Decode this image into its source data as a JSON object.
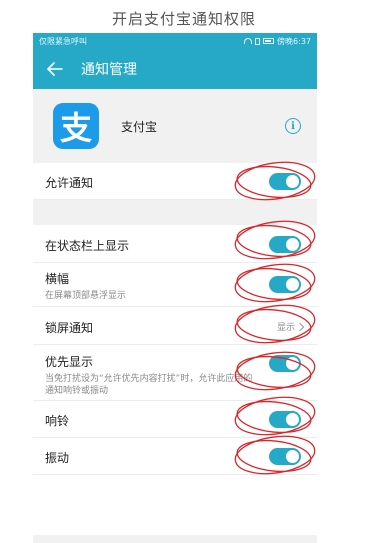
{
  "caption": "开启支付宝通知权限",
  "status_bar": {
    "left_text": "仅限紧急呼叫",
    "right_text": "傍晚6:37"
  },
  "app_bar": {
    "title": "通知管理",
    "back_icon": "back-arrow-icon"
  },
  "app": {
    "logo_glyph": "支",
    "name": "支付宝",
    "info_icon": "info-icon",
    "info_glyph": "i"
  },
  "settings": {
    "allow_notifications": {
      "title": "允许通知",
      "enabled": true
    },
    "status_bar_show": {
      "title": "在状态栏上显示",
      "enabled": true
    },
    "banner": {
      "title": "横幅",
      "subtitle": "在屏幕顶部悬浮显示",
      "enabled": true
    },
    "lock_screen": {
      "title": "锁屏通知",
      "value": "显示"
    },
    "priority": {
      "title": "优先显示",
      "subtitle": "当免打扰设为“允许优先内容打扰”时，允许此应用的通知响铃或振动",
      "enabled": true
    },
    "ringtone": {
      "title": "响铃",
      "enabled": true
    },
    "vibrate": {
      "title": "振动",
      "enabled": true
    }
  },
  "colors": {
    "accent": "#26a9c6",
    "alipay_blue": "#1c9bea",
    "annotation_red": "#d9262b"
  }
}
